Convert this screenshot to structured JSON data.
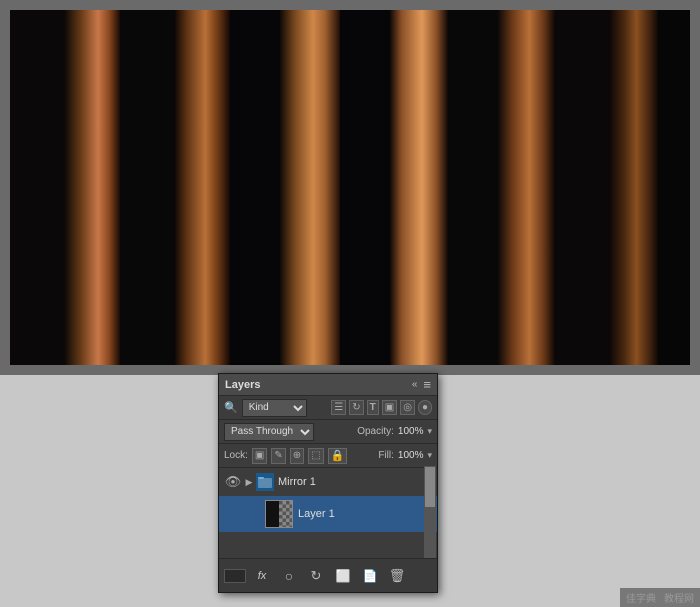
{
  "canvas": {
    "background": "#6a6a6a"
  },
  "layers_panel": {
    "title": "Layers",
    "header_icons": [
      "«",
      "≡"
    ],
    "filter_label": "Kind",
    "filter_placeholder": "Kind",
    "filter_icons": [
      "☰",
      "↺",
      "T",
      "⬜",
      "○"
    ],
    "blend_mode": "Pass Through",
    "opacity_label": "Opacity:",
    "opacity_value": "100%",
    "lock_label": "Lock:",
    "lock_icons": [
      "⬜",
      "✎",
      "⊕",
      "⬚",
      "🔒"
    ],
    "fill_label": "Fill:",
    "fill_value": "100%",
    "group_layer_name": "Mirror 1",
    "sub_layer_name": "Layer 1",
    "toolbar_icons": [
      "GO",
      "fx",
      "○",
      "↺",
      "⬜",
      "🗑"
    ]
  },
  "watermark": {
    "site1": "佳字典",
    "site2": "教程网"
  }
}
